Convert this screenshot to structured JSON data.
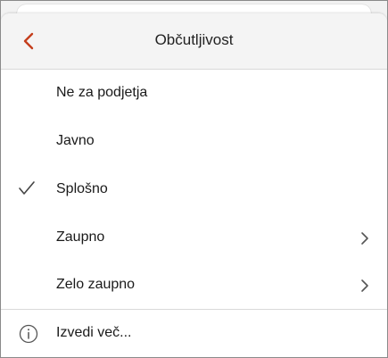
{
  "header": {
    "title": "Občutljivost",
    "back_icon": "chevron-left-icon",
    "accent_color": "#c43e1c"
  },
  "items": [
    {
      "label": "Ne za podjetja",
      "checked": false,
      "has_submenu": false
    },
    {
      "label": "Javno",
      "checked": false,
      "has_submenu": false
    },
    {
      "label": "Splošno",
      "checked": true,
      "has_submenu": false
    },
    {
      "label": "Zaupno",
      "checked": false,
      "has_submenu": true
    },
    {
      "label": "Zelo zaupno",
      "checked": false,
      "has_submenu": true
    }
  ],
  "footer": {
    "label": "Izvedi več...",
    "icon": "info-icon"
  }
}
